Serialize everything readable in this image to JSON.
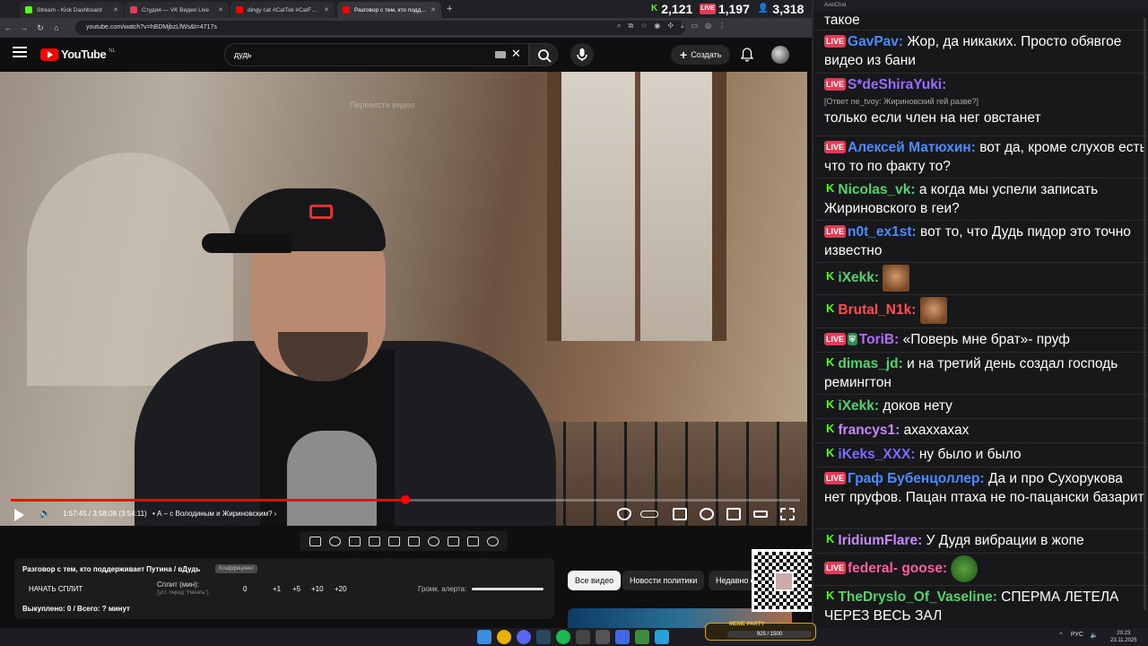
{
  "browser": {
    "tabs": [
      {
        "label": "Stream - Kick Dashboard",
        "color": "#53fc18"
      },
      {
        "label": "Студия — VK Видео Live",
        "color": "#e23b56"
      },
      {
        "label": "dingy cat #CatTok #CatFails20",
        "color": "#ff0000"
      },
      {
        "label": "Разговор с тем, кто поддержив",
        "color": "#ff0000"
      }
    ],
    "new_tab": "+",
    "url": "youtube.com/watch?v=hBDMjbzLfWs&t=4717s"
  },
  "stream_stats": {
    "kick": "2,121",
    "vk": "1,197",
    "total": "3,318"
  },
  "youtube": {
    "logo_text": "YouTube",
    "country": "NL",
    "search_query": "дудь",
    "create_label": "Создать",
    "translate_hint": "Перевести видео",
    "progress_fraction": 0.5,
    "time": "1:57:45 / 3:58:08 (3:54:11)",
    "chapter": "• А – с Володиным и Жириновским? ›",
    "filters": [
      "Все видео",
      "Новости политики",
      "Недавно о"
    ]
  },
  "split": {
    "title": "Разговор с тем, кто поддерживает Путина / вДудь",
    "badge": "Коэффициент",
    "start": "НАЧАТЬ СПЛИТ",
    "mins_label": "Сплит (мин):",
    "mins_hint": "(уст. перед \"Начать\")",
    "values": [
      "0",
      "+1",
      "+5",
      "+10",
      "+20"
    ],
    "alert_label": "Громк. алерта:",
    "footer": "Выкуплено: 0 / Всего: ? минут"
  },
  "chat": {
    "window_title": "AxelChat",
    "messages": [
      {
        "platform": "",
        "user": "",
        "color": "#ffffff",
        "text": "такое",
        "reply": ""
      },
      {
        "platform": "live",
        "user": "GavPav:",
        "color": "#4a8cff",
        "text": "Жор, да никаких. Просто обявгое видео из бани",
        "reply": ""
      },
      {
        "platform": "live",
        "user": "S*deShiraYuki:",
        "color": "#9b6bff",
        "text": "только если член на нег овстанет",
        "reply": "[Ответ ne_tvoy: Жириновский гей разве?]"
      },
      {
        "platform": "live",
        "user": "Алексей Матюхин:",
        "color": "#4a8cff",
        "text": "вот да, кроме слухов есть что то по факту то?",
        "reply": ""
      },
      {
        "platform": "kick",
        "user": "Nicolas_vk:",
        "color": "#53d36b",
        "text": "а когда мы успели записать Жириновского в геи?",
        "reply": ""
      },
      {
        "platform": "live",
        "user": "n0t_ex1st:",
        "color": "#4a8cff",
        "text": "вот то, что Дудь пидор это точно известно",
        "reply": ""
      },
      {
        "platform": "kick",
        "user": "iXekk:",
        "color": "#53d36b",
        "text": "",
        "reply": "",
        "emote": "face"
      },
      {
        "platform": "kick",
        "user": "Brutal_N1k:",
        "color": "#ff4c4c",
        "text": "",
        "reply": "",
        "emote": "face"
      },
      {
        "platform": "live-mod",
        "user": "ToriB:",
        "color": "#b56bff",
        "text": "«Поверь мне брат»- пруф",
        "reply": ""
      },
      {
        "platform": "kick",
        "user": "dimas_jd:",
        "color": "#53d36b",
        "text": "и на третий день создал господь ремингтон",
        "reply": ""
      },
      {
        "platform": "kick",
        "user": "iXekk:",
        "color": "#53d36b",
        "text": "доков нету",
        "reply": ""
      },
      {
        "platform": "kick",
        "user": "francys1:",
        "color": "#c987ff",
        "text": "ахаххахах",
        "reply": ""
      },
      {
        "platform": "kick",
        "user": "iKeks_XXX:",
        "color": "#7b6bff",
        "text": "ну было и было",
        "reply": ""
      },
      {
        "platform": "live",
        "user": "Граф Бубенцоллер:",
        "color": "#4a8cff",
        "text": "Да и про Сухорукова нет пруфов. Пацан птаха не по-пацански базарит",
        "reply": ""
      },
      {
        "platform": "kick",
        "user": "IridiumFlare:",
        "color": "#c987ff",
        "text": "У Дудя вибрации в жопе",
        "reply": ""
      },
      {
        "platform": "live",
        "user": "federal- goose:",
        "color": "#ff5c9a",
        "text": "",
        "reply": "",
        "emote": "pepe"
      },
      {
        "platform": "kick",
        "user": "TheDryslo_Of_Vaseline:",
        "color": "#53d36b",
        "text": "СПЕРМА ЛЕТЕЛА ЧЕРЕЗ ВЕСЬ ЗАЛ",
        "reply": ""
      }
    ]
  },
  "taskbar": {
    "widget_title": "MEME PARTY",
    "widget_value": "925 / 1500",
    "lang": "РУС",
    "time": "20:23",
    "date": "23.11.2025"
  }
}
